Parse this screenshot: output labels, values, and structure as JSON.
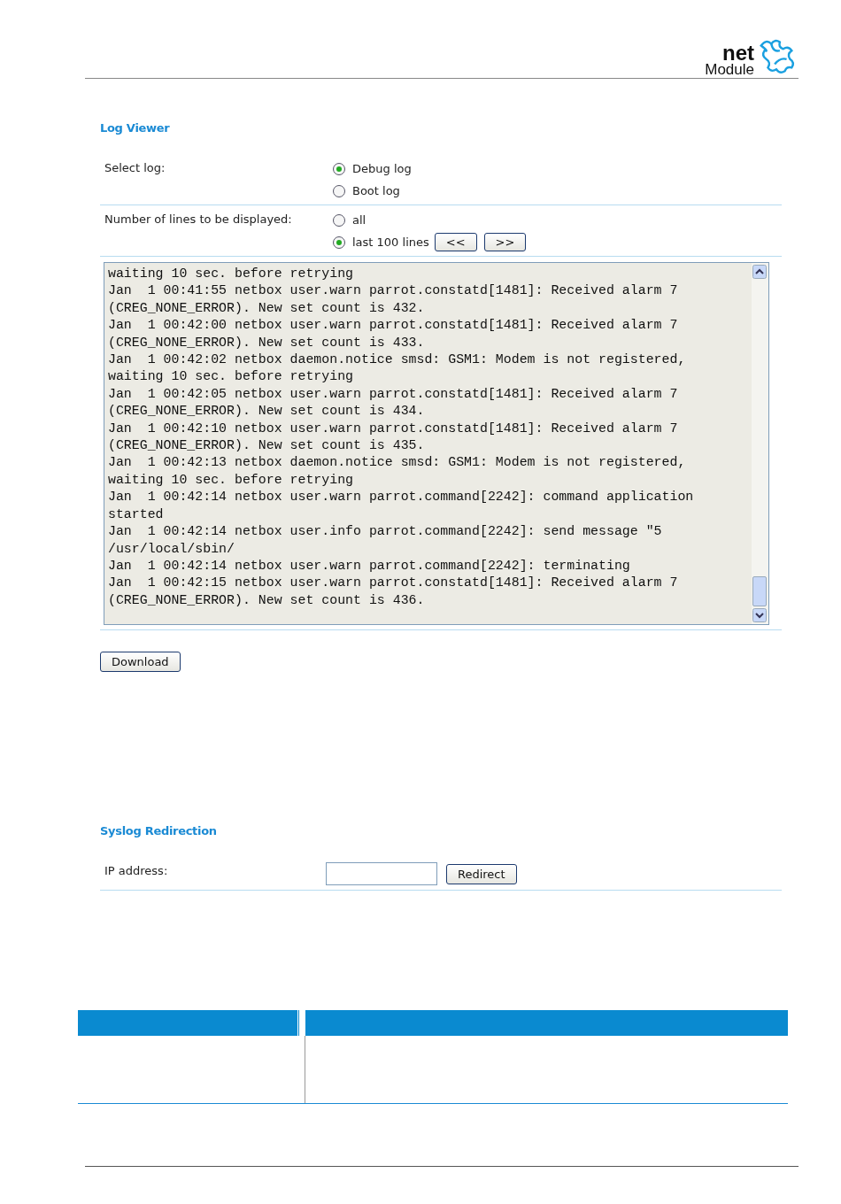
{
  "header": {
    "logo": {
      "word_top": "net",
      "word_bottom": "Module"
    }
  },
  "log_viewer": {
    "title": "Log Viewer",
    "rows": [
      {
        "label": "Select log:",
        "options": [
          {
            "label": "Debug log",
            "selected": true
          },
          {
            "label": "Boot log",
            "selected": false
          }
        ],
        "buttons": []
      },
      {
        "label": "Number of lines to be displayed:",
        "options": [
          {
            "label": "all",
            "selected": false
          },
          {
            "label": "last 100 lines",
            "selected": true
          }
        ],
        "buttons": [
          "<<",
          ">>"
        ]
      }
    ],
    "log_lines": [
      "waiting 10 sec. before retrying",
      "Jan  1 00:41:55 netbox user.warn parrot.constatd[1481]: Received alarm 7",
      "(CREG_NONE_ERROR). New set count is 432.",
      "Jan  1 00:42:00 netbox user.warn parrot.constatd[1481]: Received alarm 7",
      "(CREG_NONE_ERROR). New set count is 433.",
      "Jan  1 00:42:02 netbox daemon.notice smsd: GSM1: Modem is not registered,",
      "waiting 10 sec. before retrying",
      "Jan  1 00:42:05 netbox user.warn parrot.constatd[1481]: Received alarm 7",
      "(CREG_NONE_ERROR). New set count is 434.",
      "Jan  1 00:42:10 netbox user.warn parrot.constatd[1481]: Received alarm 7",
      "(CREG_NONE_ERROR). New set count is 435.",
      "Jan  1 00:42:13 netbox daemon.notice smsd: GSM1: Modem is not registered,",
      "waiting 10 sec. before retrying",
      "Jan  1 00:42:14 netbox user.warn parrot.command[2242]: command application",
      "started",
      "Jan  1 00:42:14 netbox user.info parrot.command[2242]: send message \"5",
      "/usr/local/sbin/",
      "Jan  1 00:42:14 netbox user.warn parrot.command[2242]: terminating",
      "Jan  1 00:42:15 netbox user.warn parrot.constatd[1481]: Received alarm 7",
      "(CREG_NONE_ERROR). New set count is 436."
    ],
    "download_button": "Download"
  },
  "syslog_redirection": {
    "title": "Syslog Redirection",
    "label": "IP address:",
    "button": "Redirect"
  }
}
